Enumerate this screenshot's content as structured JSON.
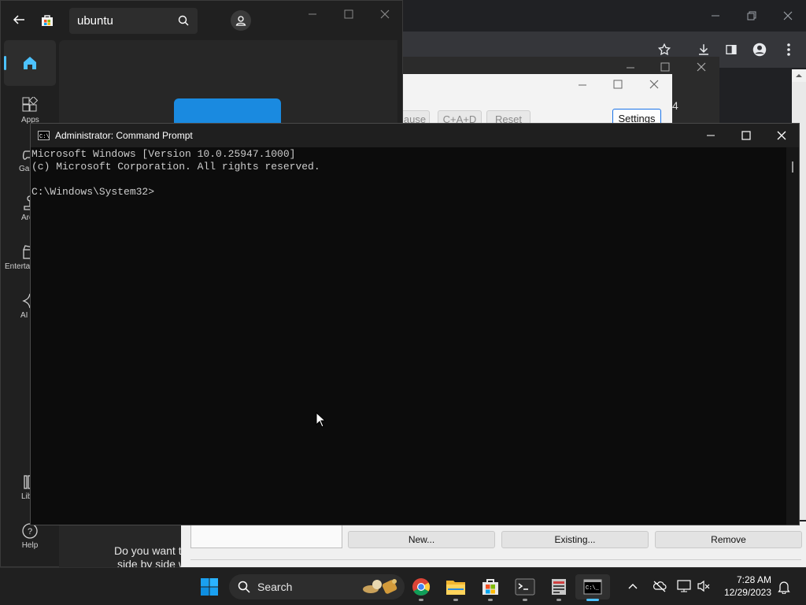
{
  "store": {
    "search_value": "ubuntu",
    "nav": [
      {
        "label": "Home"
      },
      {
        "label": "Apps"
      },
      {
        "label": "Gaming"
      },
      {
        "label": "Arcade"
      },
      {
        "label": "Entertainment"
      },
      {
        "label": "AI Hub"
      },
      {
        "label": "Library"
      },
      {
        "label": "Help"
      }
    ],
    "promo_text": "Do you want t",
    "promo_text2": "side by side w"
  },
  "background_dialog": {
    "buttons": [
      "ause",
      "C+A+D",
      "Reset",
      "Settings"
    ],
    "number": "4"
  },
  "bg_panel": {
    "buttons": [
      "New...",
      "Existing...",
      "Remove"
    ]
  },
  "cmd": {
    "title": "Administrator: Command Prompt",
    "lines": [
      "Microsoft Windows [Version 10.0.25947.1000]",
      "(c) Microsoft Corporation. All rights reserved.",
      "",
      "C:\\Windows\\System32>"
    ]
  },
  "taskbar": {
    "search_label": "Search",
    "time": "7:28 AM",
    "date": "12/29/2023"
  }
}
